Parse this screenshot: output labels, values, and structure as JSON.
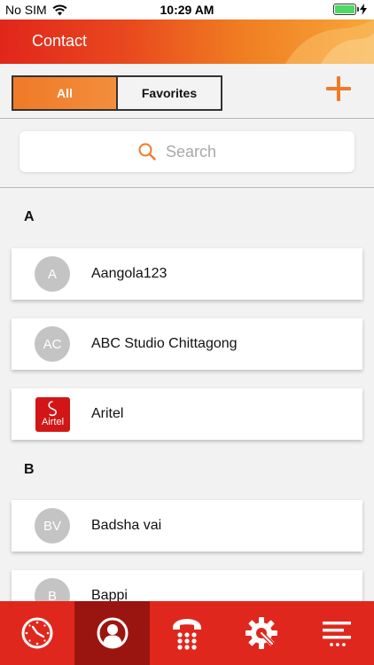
{
  "status_bar": {
    "carrier": "No SIM",
    "time": "10:29 AM"
  },
  "header": {
    "title": "Contact"
  },
  "segment": {
    "all_label": "All",
    "favorites_label": "Favorites"
  },
  "search": {
    "placeholder": "Search"
  },
  "sections": [
    {
      "letter": "A",
      "contacts": [
        {
          "initials": "A",
          "name": "Aangola123"
        },
        {
          "initials": "AC",
          "name": "ABC Studio Chittagong"
        },
        {
          "initials": "Airtel",
          "name": "Aritel"
        }
      ]
    },
    {
      "letter": "B",
      "contacts": [
        {
          "initials": "BV",
          "name": "Badsha vai"
        },
        {
          "initials": "B",
          "name": "Bappi"
        }
      ]
    }
  ],
  "tabs": [
    {
      "icon": "clock-icon"
    },
    {
      "icon": "person-icon",
      "active": true
    },
    {
      "icon": "dialpad-icon"
    },
    {
      "icon": "settings-icon"
    },
    {
      "icon": "menu-icon"
    }
  ],
  "colors": {
    "header_start": "#e1261c",
    "header_end": "#f7a73a",
    "accent": "#ef7a26",
    "tab_bar": "#e0271d",
    "tab_active": "#9b1510"
  }
}
